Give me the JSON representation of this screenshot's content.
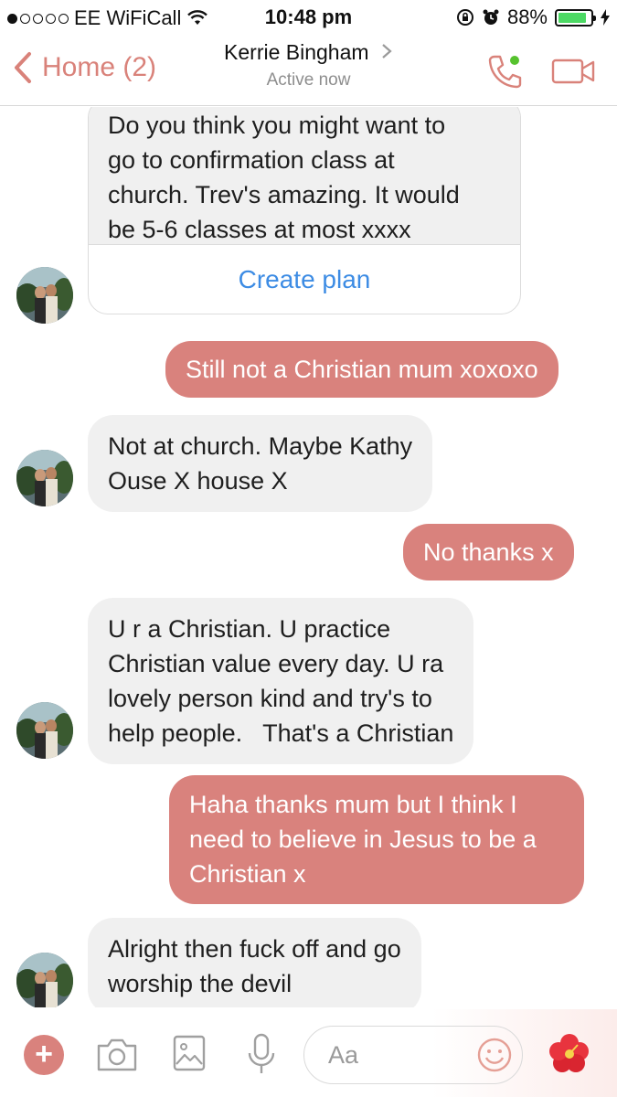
{
  "status": {
    "carrier": "EE WiFiCall",
    "time": "10:48 pm",
    "battery": "88%",
    "battery_level": 0.88
  },
  "header": {
    "back_label": "Home (2)",
    "contact_name": "Kerrie Bingham",
    "contact_status": "Active now"
  },
  "messages": {
    "m1_lines": [
      "Do you think you might want to",
      "go to confirmation class at",
      "church. Trev's amazing. It would",
      "be 5-6 classes at most xxxx"
    ],
    "m1_action": "Create plan",
    "m2": "Still not a Christian mum xoxoxo",
    "m3_lines": [
      "Not at church. Maybe Kathy",
      "Ouse X house X"
    ],
    "m4": "No thanks x",
    "m5_lines": [
      "U r a Christian. U practice",
      "Christian value every day. U ra",
      "lovely person kind and try's to",
      "help people.   That's a Christian"
    ],
    "m6_lines": [
      "Haha thanks mum but I think I",
      "need to believe in Jesus to be a",
      "Christian x"
    ],
    "m7_lines": [
      "Alright then fuck off and go",
      "worship the devil"
    ]
  },
  "composer": {
    "placeholder": "Aa",
    "plus": "+"
  },
  "colors": {
    "accent": "#d9827d",
    "incoming_bg": "#f0f0f0",
    "link": "#3d8ce4"
  }
}
